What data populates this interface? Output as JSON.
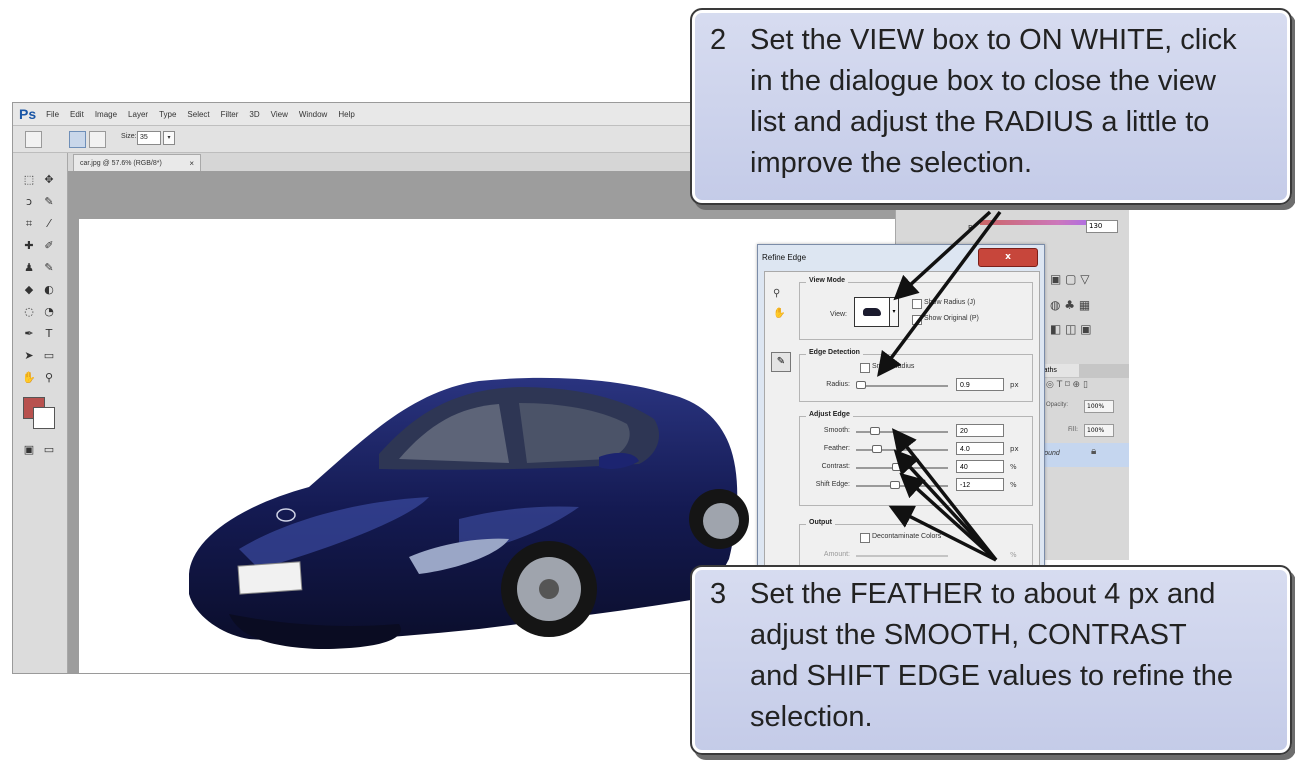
{
  "app": {
    "logo": "Ps"
  },
  "menubar": {
    "items": [
      "File",
      "Edit",
      "Image",
      "Layer",
      "Type",
      "Select",
      "Filter",
      "3D",
      "View",
      "Window",
      "Help"
    ]
  },
  "options_bar": {
    "size_label": "Size:",
    "size_value": "35"
  },
  "document": {
    "tab_label": "car.jpg @ 57.6% (RGB/8*)",
    "close_glyph": "×"
  },
  "right_panel": {
    "b_label": "B",
    "b_value": "130",
    "paths_tab": "Paths",
    "opacity_label": "Opacity:",
    "opacity_value": "100%",
    "fill_label": "Fill:",
    "fill_value": "100%",
    "layer_name": "ground"
  },
  "refine_edge": {
    "title": "Refine Edge",
    "close_glyph": "x",
    "view_mode": {
      "title": "View Mode",
      "view_label": "View:",
      "show_radius": "Show Radius (J)",
      "show_original": "Show Original (P)"
    },
    "edge_detection": {
      "title": "Edge Detection",
      "smart_radius": "Smart Radius",
      "radius_label": "Radius:",
      "radius_value": "0.9",
      "radius_unit": "px"
    },
    "adjust_edge": {
      "title": "Adjust Edge",
      "smooth_label": "Smooth:",
      "smooth_value": "20",
      "feather_label": "Feather:",
      "feather_value": "4.0",
      "feather_unit": "px",
      "contrast_label": "Contrast:",
      "contrast_value": "40",
      "contrast_unit": "%",
      "shift_label": "Shift Edge:",
      "shift_value": "-12",
      "shift_unit": "%"
    },
    "output": {
      "title": "Output",
      "decontaminate": "Decontaminate Colors",
      "amount_label": "Amount:",
      "amount_unit": "%"
    }
  },
  "callout_2": {
    "number": "2",
    "lines": [
      "Set the VIEW box to ON WHITE, click",
      "in the dialogue box to close the view",
      "list and adjust the RADIUS a little to",
      "improve the selection."
    ]
  },
  "callout_3": {
    "number": "3",
    "lines": [
      "Set the FEATHER to about 4 px and",
      "adjust the SMOOTH, CONTRAST",
      "and SHIFT EDGE values to refine the",
      "selection."
    ]
  },
  "colors": {
    "foreground": "#b8514e",
    "background": "#ffffff",
    "car_body": "#141a52",
    "callout_fill": "#c9cfea"
  }
}
